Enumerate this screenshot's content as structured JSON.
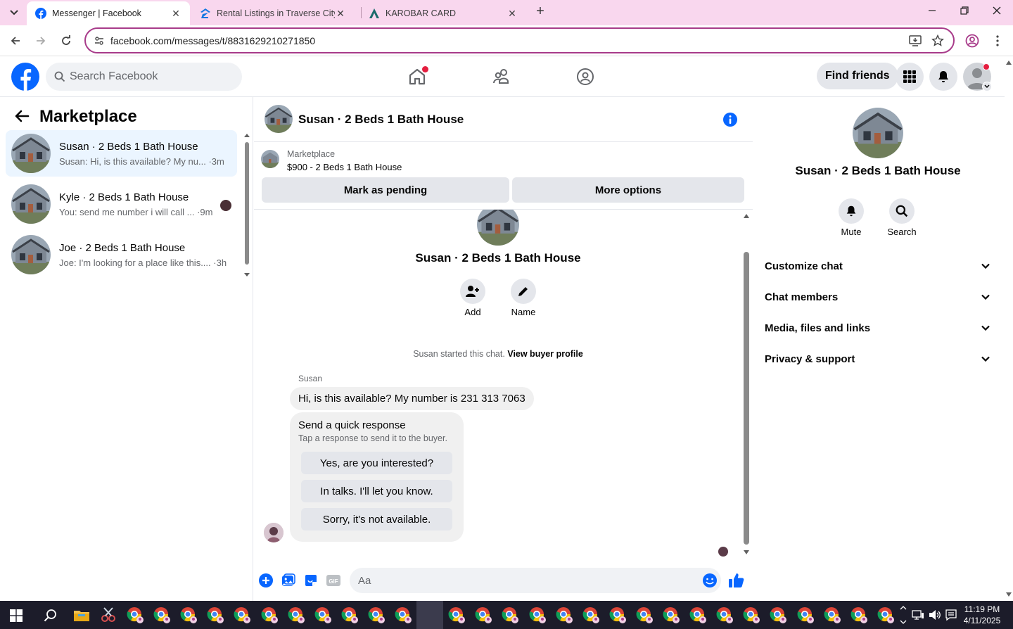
{
  "browser": {
    "tabs": [
      {
        "title": "Messenger | Facebook",
        "active": true
      },
      {
        "title": "Rental Listings in Traverse City M",
        "active": false
      },
      {
        "title": "KAROBAR CARD",
        "active": false
      }
    ],
    "url": "facebook.com/messages/t/8831629210271850"
  },
  "fb_header": {
    "search_placeholder": "Search Facebook",
    "find_friends_label": "Find friends"
  },
  "sidebar": {
    "title": "Marketplace",
    "conversations": [
      {
        "name": "Susan · 2 Beds 1 Bath House",
        "preview": "Susan: Hi, is this available? My nu...",
        "time": "·3m",
        "active": true
      },
      {
        "name": "Kyle · 2 Beds 1 Bath House",
        "preview": "You: send me number i will call ...",
        "time": "·9m",
        "active": false
      },
      {
        "name": "Joe · 2 Beds 1 Bath House",
        "preview": "Joe: I'm looking for a place like this....",
        "time": "·3h",
        "active": false
      }
    ]
  },
  "chat": {
    "header_name": "Susan · 2 Beds 1 Bath House",
    "listing": {
      "source": "Marketplace",
      "title": "$900 - 2 Beds 1 Bath House",
      "mark_pending_label": "Mark as pending",
      "more_options_label": "More options"
    },
    "intro": {
      "name": "Susan · 2 Beds 1 Bath House",
      "add_label": "Add",
      "name_label": "Name",
      "started_text": "Susan started this chat.",
      "view_profile_label": "View buyer profile"
    },
    "message": {
      "sender": "Susan",
      "text": "Hi, is this available? My number is 231 313 7063"
    },
    "quick_response": {
      "title": "Send a quick response",
      "subtitle": "Tap a response to send it to the buyer.",
      "options": [
        "Yes, are you interested?",
        "In talks. I'll let you know.",
        "Sorry, it's not available."
      ]
    },
    "composer_placeholder": "Aa",
    "composer_icons": [
      "plus-icon",
      "photo-icon",
      "sticker-icon",
      "gif-icon",
      "emoji-icon",
      "like-icon"
    ]
  },
  "right_panel": {
    "name": "Susan · 2 Beds 1 Bath House",
    "actions": [
      {
        "label": "Mute"
      },
      {
        "label": "Search"
      }
    ],
    "sections": [
      "Customize chat",
      "Chat members",
      "Media, files and links",
      "Privacy & support"
    ]
  },
  "taskbar": {
    "time": "11:19 PM",
    "date": "4/11/2025"
  },
  "colors": {
    "fb_blue": "#0866ff",
    "tab_strip": "#f9d7ee",
    "omnibox_border": "#a83b8a",
    "active_conversation": "#ebf5ff"
  }
}
